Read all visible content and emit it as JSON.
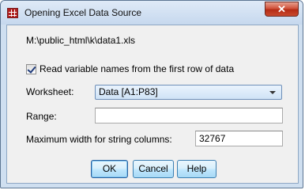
{
  "window": {
    "title": "Opening Excel Data Source",
    "close_glyph": "✕"
  },
  "source": {
    "path": "M:\\public_html\\k\\data1.xls"
  },
  "options": {
    "read_names_label": "Read variable names from the first row of data",
    "read_names_checked": true
  },
  "worksheet": {
    "label": "Worksheet:",
    "selected": "Data [A1:P83]"
  },
  "range": {
    "label": "Range:",
    "value": ""
  },
  "max_width": {
    "label": "Maximum width for string columns:",
    "value": "32767"
  },
  "buttons": {
    "ok": "OK",
    "cancel": "Cancel",
    "help": "Help"
  }
}
